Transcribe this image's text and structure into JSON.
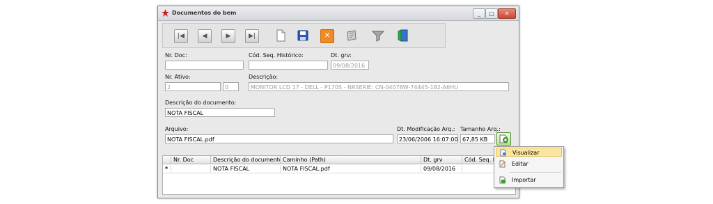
{
  "window": {
    "title": "Documentos do bem",
    "controls": {
      "minimize": "_",
      "maximize": "□",
      "close": "✕"
    }
  },
  "toolbar": {
    "buttons": [
      {
        "name": "first-record",
        "glyph": "|◀"
      },
      {
        "name": "previous-record",
        "glyph": "◀"
      },
      {
        "name": "next-record",
        "glyph": "▶"
      },
      {
        "name": "last-record",
        "glyph": "▶|"
      },
      {
        "name": "new-document"
      },
      {
        "name": "save"
      },
      {
        "name": "cancel",
        "glyph": "✕"
      },
      {
        "name": "scan"
      },
      {
        "name": "filter"
      },
      {
        "name": "exit"
      }
    ]
  },
  "form": {
    "nr_doc": {
      "label": "Nr. Doc:",
      "value": ""
    },
    "cod_seq_historico": {
      "label": "Cód. Seq. Histórico:",
      "value": ""
    },
    "dt_grv": {
      "label": "Dt. grv:",
      "value": "09/08/2016"
    },
    "nr_ativo": {
      "label": "Nr. Ativo:",
      "value": "2",
      "value2": "0"
    },
    "descricao": {
      "label": "Descrição:",
      "value": "MONITOR LCD 17 - DELL - P170S - NRSERIE: CN-04078W-74445-182-A6HU"
    },
    "descricao_documento": {
      "label": "Descrição do documento:",
      "value": "NOTA FISCAL"
    },
    "arquivo": {
      "label": "Arquivo:",
      "value": "NOTA FISCAL.pdf"
    },
    "dt_modificacao": {
      "label": "Dt. Modificação Arq.:",
      "value": "23/06/2006 16:07:00"
    },
    "tamanho": {
      "label": "Tamanho Arq.:",
      "value": "67,85 KB"
    }
  },
  "grid": {
    "columns": [
      "",
      "Nr. Doc",
      "Descrição do documento",
      "Caminho (Path)",
      "Dt. grv",
      "Cód. Seq. Histó"
    ],
    "rows": [
      [
        "*",
        "",
        "NOTA FISCAL",
        "NOTA FISCAL.pdf",
        "09/08/2016",
        ""
      ]
    ]
  },
  "context_menu": {
    "items": [
      {
        "label": "Visualizar",
        "icon": "view-document-icon",
        "selected": true
      },
      {
        "label": "Editar",
        "icon": "edit-document-icon",
        "selected": false
      },
      {
        "label": "Importar",
        "icon": "import-document-icon",
        "selected": false
      }
    ]
  },
  "colors": {
    "menu_highlight": "#fbe6a0",
    "close_button": "#c74a36",
    "app_icon": "#c8171d"
  }
}
